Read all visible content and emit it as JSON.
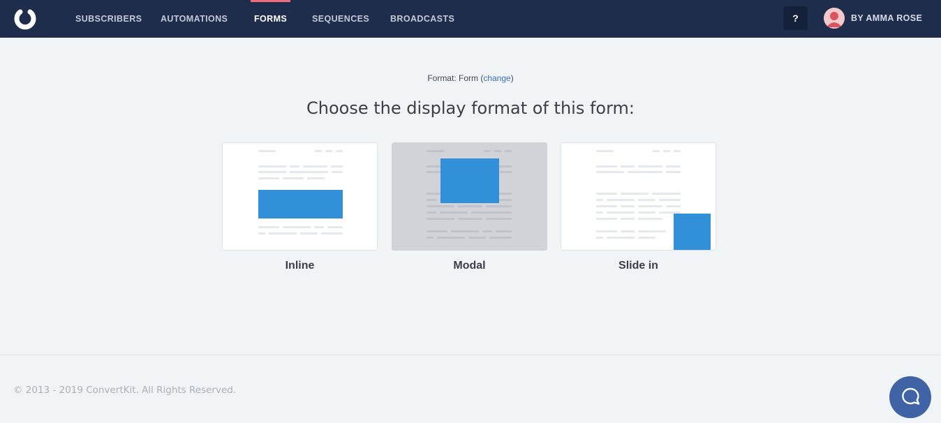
{
  "nav": {
    "items": [
      {
        "label": "SUBSCRIBERS",
        "active": false
      },
      {
        "label": "AUTOMATIONS",
        "active": false
      },
      {
        "label": "FORMS",
        "active": true
      },
      {
        "label": "SEQUENCES",
        "active": false
      },
      {
        "label": "BROADCASTS",
        "active": false
      }
    ],
    "help_label": "?",
    "user_name": "BY AMMA ROSE",
    "accent_color": "#ee6b79",
    "background_color": "#1f2d4d"
  },
  "main": {
    "format_prefix": "Format: Form (",
    "format_link": "change",
    "format_suffix": ")",
    "heading": "Choose the display format of this form:",
    "options": [
      {
        "label": "Inline",
        "selected": false,
        "icon": "inline-form-preview"
      },
      {
        "label": "Modal",
        "selected": true,
        "icon": "modal-form-preview"
      },
      {
        "label": "Slide in",
        "selected": false,
        "icon": "slide-in-form-preview"
      }
    ],
    "preview_blue": "#3190d8"
  },
  "footer": {
    "copyright": "© 2013 - 2019 ConvertKit. All Rights Reserved."
  }
}
